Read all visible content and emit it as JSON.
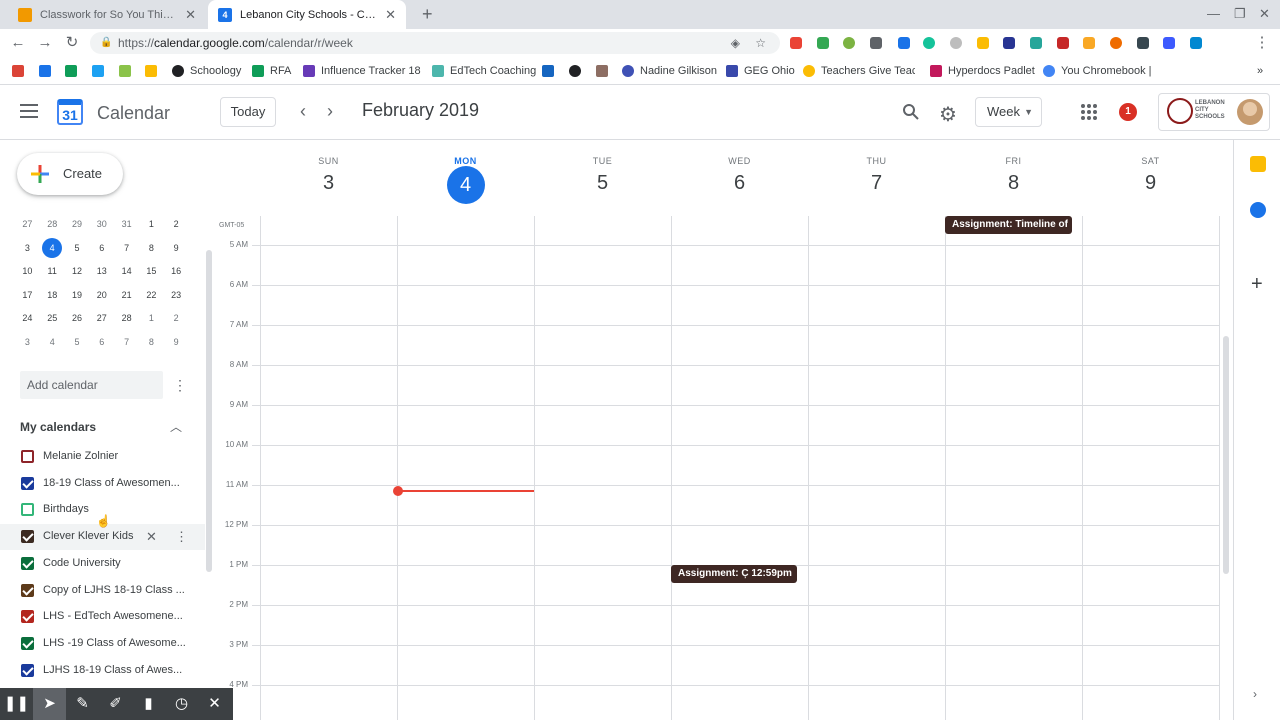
{
  "browser": {
    "tabs": [
      {
        "title": "Classwork for So You Think You",
        "favicon_color": "#f29900"
      },
      {
        "title": "Lebanon City Schools - Calendar",
        "favicon_color": "#1a73e8",
        "favicon_text": "4"
      }
    ],
    "url": {
      "scheme": "https://",
      "host": "calendar.google.com",
      "path": "/calendar/r/week"
    },
    "bookmarks": [
      {
        "label": "",
        "color": "#db4437"
      },
      {
        "label": "",
        "color": "#1a73e8"
      },
      {
        "label": "",
        "color": "#0f9d58"
      },
      {
        "label": "",
        "color": "#1da1f2"
      },
      {
        "label": "",
        "color": "#8bc34a"
      },
      {
        "label": "",
        "color": "#fbbc04"
      },
      {
        "label": "Schoology",
        "color": "#202124"
      },
      {
        "label": "RFA",
        "color": "#0f9d58"
      },
      {
        "label": "Influence Tracker 18",
        "color": "#673ab7"
      },
      {
        "label": "EdTech Coaching",
        "color": "#4db6ac"
      },
      {
        "label": "",
        "color": "#1565c0"
      },
      {
        "label": "",
        "color": "#202124"
      },
      {
        "label": "",
        "color": "#8d6e63"
      },
      {
        "label": "Nadine Gilkison",
        "color": "#3f51b5"
      },
      {
        "label": "GEG Ohio",
        "color": "#3949ab"
      },
      {
        "label": "Teachers Give Teach",
        "color": "#fbbc04"
      },
      {
        "label": "Hyperdocs Padlet",
        "color": "#c2185b"
      },
      {
        "label": "You Chromebook | G",
        "color": "#4285f4"
      }
    ]
  },
  "header": {
    "app_title": "Calendar",
    "logo_day": "31",
    "today_label": "Today",
    "month_title": "February 2019",
    "view_label": "Week",
    "notification_count": "1",
    "school_name": "LEBANON CITY SCHOOLS"
  },
  "sidebar": {
    "create_label": "Create",
    "mini_calendar": {
      "weeks": [
        [
          "27",
          "28",
          "29",
          "30",
          "31",
          "1",
          "2"
        ],
        [
          "3",
          "4",
          "5",
          "6",
          "7",
          "8",
          "9"
        ],
        [
          "10",
          "11",
          "12",
          "13",
          "14",
          "15",
          "16"
        ],
        [
          "17",
          "18",
          "19",
          "20",
          "21",
          "22",
          "23"
        ],
        [
          "24",
          "25",
          "26",
          "27",
          "28",
          "1",
          "2"
        ],
        [
          "3",
          "4",
          "5",
          "6",
          "7",
          "8",
          "9"
        ]
      ],
      "selected": "4"
    },
    "add_calendar_placeholder": "Add calendar",
    "my_calendars_label": "My calendars",
    "calendars": [
      {
        "name": "Melanie Zolnier",
        "color": "#8e2429",
        "checked": false
      },
      {
        "name": "18-19 Class of Awesomen...",
        "color": "#1a3a9c",
        "checked": true
      },
      {
        "name": "Birthdays",
        "color": "#33b679",
        "checked": false
      },
      {
        "name": "Clever Klever Kids",
        "color": "#3c2a21",
        "checked": true
      },
      {
        "name": "Code University",
        "color": "#0b6e3c",
        "checked": true
      },
      {
        "name": "Copy of LJHS 18-19 Class ...",
        "color": "#5d3a1a",
        "checked": true
      },
      {
        "name": "LHS - EdTech Awesomene...",
        "color": "#b3261e",
        "checked": true
      },
      {
        "name": "LHS -19 Class of Awesome...",
        "color": "#0b6e3c",
        "checked": true
      },
      {
        "name": "LJHS 18-19 Class of Awes...",
        "color": "#1a3a9c",
        "checked": true
      }
    ]
  },
  "week": {
    "timezone": "GMT-05",
    "days": [
      {
        "name": "SUN",
        "num": "3"
      },
      {
        "name": "MON",
        "num": "4",
        "today": true
      },
      {
        "name": "TUE",
        "num": "5"
      },
      {
        "name": "WED",
        "num": "6"
      },
      {
        "name": "THU",
        "num": "7"
      },
      {
        "name": "FRI",
        "num": "8"
      },
      {
        "name": "SAT",
        "num": "9"
      }
    ],
    "hours": [
      "5 AM",
      "6 AM",
      "7 AM",
      "8 AM",
      "9 AM",
      "10 AM",
      "11 AM",
      "12 PM",
      "1 PM",
      "2 PM",
      "3 PM",
      "4 PM"
    ],
    "events": [
      {
        "label": "Assignment: Timeline of",
        "day": "FRI"
      },
      {
        "label": "Assignment: C̦ 12:59pm",
        "day": "WED",
        "time": "12:59pm"
      }
    ]
  },
  "colors": {
    "accent": "#1a73e8",
    "now_line": "#ea4335",
    "event_bg": "#3e2723"
  },
  "icons": {
    "menu": "hamburger-icon",
    "search": "search-icon",
    "settings": "gear-icon",
    "apps": "apps-grid-icon"
  }
}
